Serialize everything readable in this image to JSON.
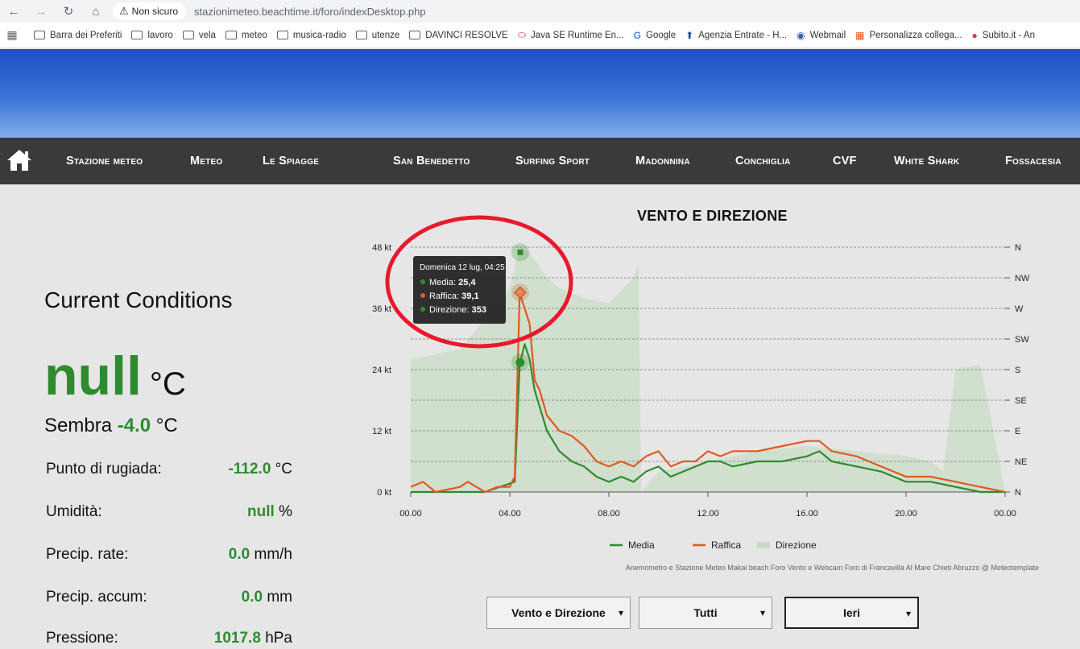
{
  "browser": {
    "insecure_label": "Non sicuro",
    "url": "stazionimeteo.beachtime.it/foro/indexDesktop.php"
  },
  "bookmarks": [
    {
      "label": "Barra dei Preferiti",
      "icon": "folder-icon"
    },
    {
      "label": "lavoro",
      "icon": "folder-icon"
    },
    {
      "label": "vela",
      "icon": "folder-icon"
    },
    {
      "label": "meteo",
      "icon": "folder-icon"
    },
    {
      "label": "musica-radio",
      "icon": "folder-icon"
    },
    {
      "label": "utenze",
      "icon": "folder-icon"
    },
    {
      "label": "DAVINCI RESOLVE",
      "icon": "folder-icon"
    },
    {
      "label": "Java SE Runtime En...",
      "icon": "java-icon"
    },
    {
      "label": "Google",
      "icon": "google-icon"
    },
    {
      "label": "Agenzia Entrate - H...",
      "icon": "agenzia-icon"
    },
    {
      "label": "Webmail",
      "icon": "webmail-icon"
    },
    {
      "label": "Personalizza collega...",
      "icon": "microsoft-icon"
    },
    {
      "label": "Subito.it - An",
      "icon": "subito-icon"
    }
  ],
  "nav": {
    "items": [
      "Stazione meteo",
      "Meteo",
      "Le Spiagge",
      "San Benedetto",
      "Surfing Sport",
      "Madonnina",
      "Conchiglia",
      "CVF",
      "White Shark",
      "Fossacesia"
    ]
  },
  "conditions": {
    "title": "Current Conditions",
    "temp_value": "null",
    "temp_unit": "°C",
    "feels_label": "Sembra",
    "feels_value": "-4.0",
    "feels_unit": "°C",
    "rows": [
      {
        "label": "Punto di rugiada:",
        "value": "-112.0",
        "unit": "°C"
      },
      {
        "label": "Umidità:",
        "value": "null",
        "unit": "%"
      },
      {
        "label": "Precip. rate:",
        "value": "0.0",
        "unit": "mm/h"
      },
      {
        "label": "Precip. accum:",
        "value": "0.0",
        "unit": "mm"
      },
      {
        "label": "Pressione:",
        "value": "1017.8",
        "unit": "hPa"
      }
    ]
  },
  "chart_data": {
    "type": "line",
    "title": "VENTO E DIREZIONE",
    "x_ticks": [
      "00.00",
      "04.00",
      "08.00",
      "12.00",
      "16.00",
      "20.00",
      "00.00"
    ],
    "y_ticks": [
      "0 kt",
      "12 kt",
      "24 kt",
      "36 kt",
      "48 kt"
    ],
    "ylim": [
      0,
      48
    ],
    "direction_ticks": [
      "N",
      "NE",
      "E",
      "SE",
      "S",
      "SW",
      "W",
      "NW",
      "N"
    ],
    "legend": [
      "Media",
      "Raffica",
      "Direzione"
    ],
    "legend_position": "bottom",
    "grid": true,
    "colors": {
      "media": "#2e8b2e",
      "raffica": "#e05a1e",
      "direzione": "#c9dcc6"
    },
    "series": [
      {
        "name": "Media",
        "x": [
          0,
          1,
          2,
          3,
          4.2,
          4.4,
          4.6,
          4.8,
          5.0,
          5.5,
          6,
          6.5,
          7,
          7.5,
          8,
          8.5,
          9,
          9.5,
          10,
          10.5,
          11,
          11.5,
          12,
          12.5,
          13,
          14,
          15,
          16,
          16.5,
          17,
          18,
          19,
          20,
          21,
          22,
          23,
          24
        ],
        "y": [
          0,
          0,
          0,
          0,
          2,
          25,
          29,
          26,
          20,
          12,
          8,
          6,
          5,
          3,
          2,
          3,
          2,
          4,
          5,
          3,
          4,
          5,
          6,
          6,
          5,
          6,
          6,
          7,
          8,
          6,
          5,
          4,
          2,
          2,
          1,
          0,
          0
        ]
      },
      {
        "name": "Raffica",
        "x": [
          0,
          0.5,
          1,
          2,
          2.3,
          3,
          3.5,
          4,
          4.2,
          4.4,
          4.6,
          4.8,
          5.0,
          5.2,
          5.5,
          6,
          6.5,
          7,
          7.5,
          8,
          8.5,
          9,
          9.5,
          10,
          10.5,
          11,
          11.5,
          12,
          12.5,
          13,
          14,
          15,
          16,
          16.5,
          17,
          18,
          19,
          20,
          21,
          22,
          23,
          24
        ],
        "y": [
          1,
          2,
          0,
          1,
          2,
          0,
          1,
          1,
          3,
          39,
          36,
          33,
          22,
          20,
          15,
          12,
          11,
          9,
          6,
          5,
          6,
          5,
          7,
          8,
          5,
          6,
          6,
          8,
          7,
          8,
          8,
          9,
          10,
          10,
          8,
          7,
          5,
          3,
          3,
          2,
          1,
          0
        ]
      },
      {
        "name": "Direzione",
        "x": [
          0,
          2,
          4,
          4.4,
          4.8,
          5.5,
          6,
          7,
          8,
          9,
          9.2,
          9.3,
          10,
          12,
          14,
          16,
          18,
          20,
          21,
          21.5,
          22,
          23,
          24
        ],
        "y": [
          26,
          28,
          40,
          48,
          47,
          42,
          40,
          38,
          37,
          42,
          45,
          0,
          4,
          6,
          8,
          9,
          8,
          7,
          6,
          4,
          24,
          25,
          0
        ]
      }
    ],
    "tooltip": {
      "title": "Domenica 12 lug, 04:25",
      "items": [
        {
          "label": "Media",
          "value": "25,4"
        },
        {
          "label": "Raffica",
          "value": "39,1"
        },
        {
          "label": "Direzione",
          "value": "353"
        }
      ],
      "x": 4.42
    },
    "credits": "Anemometro e Stazione Meteo Makai beach Foro Vento e Webcam Foro di Francavilla Al Mare Chieti Abruzzo @ Meteotemplate"
  },
  "selects": [
    {
      "value": "Vento e Direzione"
    },
    {
      "value": "Tutti"
    },
    {
      "value": "Ieri"
    }
  ],
  "annotation_color": "#e8192c"
}
